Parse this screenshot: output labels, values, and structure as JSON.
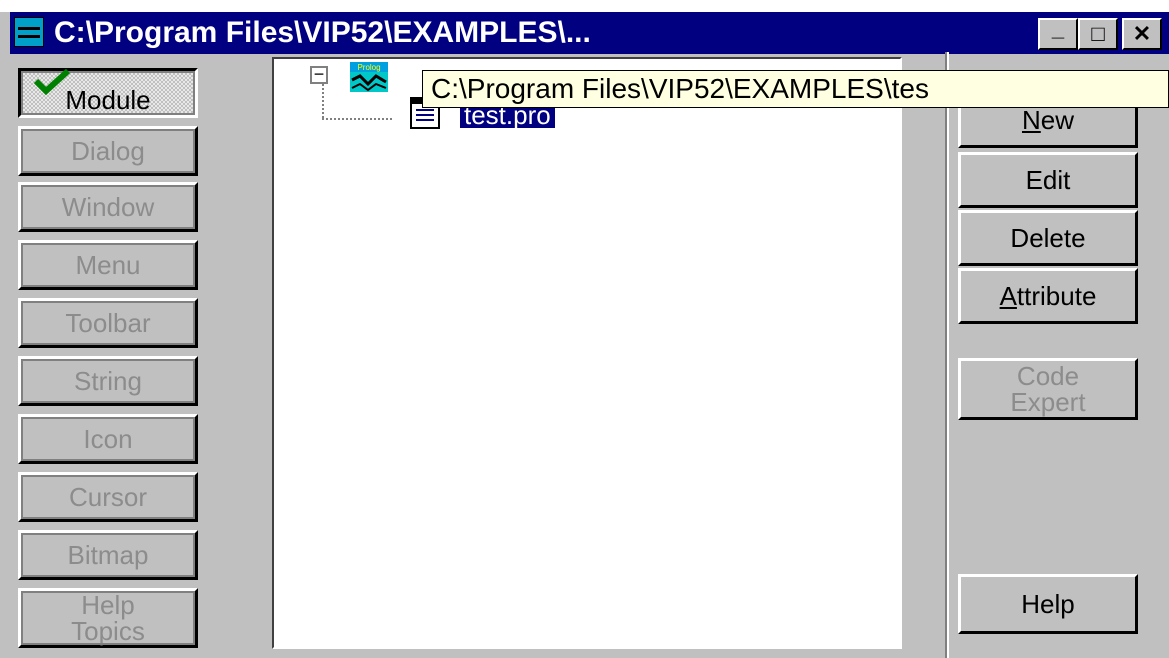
{
  "window": {
    "title": "C:\\Program Files\\VIP52\\EXAMPLES\\...",
    "controls": {
      "minimize": "_",
      "maximize": "□",
      "close": "✕"
    }
  },
  "left_buttons": [
    {
      "label": "Module",
      "state": "active"
    },
    {
      "label": "Dialog",
      "state": "disabled"
    },
    {
      "label": "Window",
      "state": "disabled"
    },
    {
      "label": "Menu",
      "state": "disabled"
    },
    {
      "label": "Toolbar",
      "state": "disabled"
    },
    {
      "label": "String",
      "state": "disabled"
    },
    {
      "label": "Icon",
      "state": "disabled"
    },
    {
      "label": "Cursor",
      "state": "disabled"
    },
    {
      "label": "Bitmap",
      "state": "disabled"
    },
    {
      "label": "Help Topics",
      "state": "disabled"
    }
  ],
  "tree": {
    "root_icon": "prolog-project-icon",
    "root_icon_text": "Prolog",
    "root_tooltip": "C:\\Program Files\\VIP52\\EXAMPLES\\tes",
    "children": [
      {
        "label": "test.pro",
        "icon": "document-icon",
        "selected": true
      }
    ]
  },
  "right_buttons": [
    {
      "label": "New",
      "underline": "N"
    },
    {
      "label": "Edit"
    },
    {
      "label": "Delete"
    },
    {
      "label": "Attribute",
      "underline": "A"
    },
    {
      "label": "Code Expert",
      "state": "disabled"
    },
    {
      "label": "Help"
    }
  ],
  "colors": {
    "title_bar": "#000080",
    "face": "#c0c0c0",
    "tooltip": "#ffffe1",
    "selection": "#000080"
  }
}
